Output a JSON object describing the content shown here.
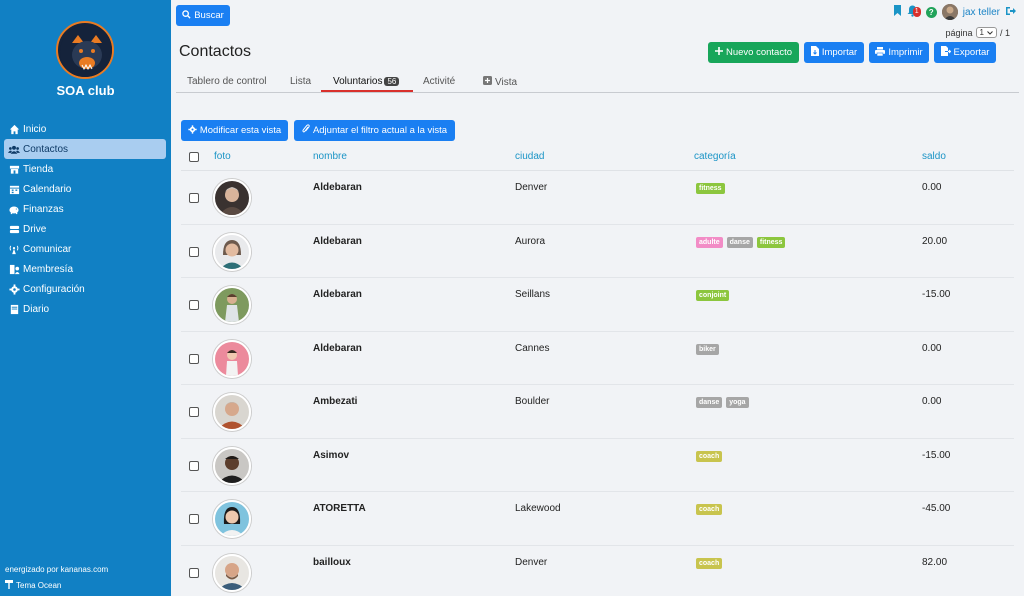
{
  "sidebar": {
    "club_name": "SOA club",
    "items": [
      {
        "label": "Inicio",
        "icon": "home-icon",
        "active": false
      },
      {
        "label": "Contactos",
        "icon": "users-icon",
        "active": true
      },
      {
        "label": "Tienda",
        "icon": "store-icon",
        "active": false
      },
      {
        "label": "Calendario",
        "icon": "calendar-icon",
        "active": false
      },
      {
        "label": "Finanzas",
        "icon": "piggy-bank-icon",
        "active": false
      },
      {
        "label": "Drive",
        "icon": "hard-drive-icon",
        "active": false
      },
      {
        "label": "Comunicar",
        "icon": "broadcast-icon",
        "active": false
      },
      {
        "label": "Membresía",
        "icon": "membership-icon",
        "active": false
      },
      {
        "label": "Configuración",
        "icon": "gear-icon",
        "active": false
      },
      {
        "label": "Diario",
        "icon": "journal-icon",
        "active": false
      }
    ],
    "powered_by": "energizado por kananas.com",
    "theme": "Tema Ocean"
  },
  "header": {
    "search_label": "Buscar",
    "page_title": "Contactos",
    "notifications_count": "1",
    "help": "?",
    "user_name": "jax teller",
    "pager_label": "página",
    "pager_value": "1",
    "pager_total": "/ 1",
    "new_contact": "Nuevo contacto",
    "import": "Importar",
    "print": "Imprimir",
    "export": "Exportar"
  },
  "tabs": [
    {
      "label": "Tablero de control"
    },
    {
      "label": "Lista"
    },
    {
      "label": "Voluntarios",
      "badge": "56"
    },
    {
      "label": "Activité"
    },
    {
      "label": "Vista"
    }
  ],
  "actions": {
    "modify_view": "Modificar esta vista",
    "attach_filter": "Adjuntar el filtro actual a la vista"
  },
  "table": {
    "columns": {
      "photo": "foto",
      "name": "nombre",
      "city": "ciudad",
      "category": "categoría",
      "balance": "saldo"
    },
    "rows": [
      {
        "name": "Aldebaran",
        "city": "Denver",
        "tags": [
          "fitness"
        ],
        "balance": "0.00"
      },
      {
        "name": "Aldebaran",
        "city": "Aurora",
        "tags": [
          "adulte",
          "danse",
          "fitness"
        ],
        "balance": "20.00"
      },
      {
        "name": "Aldebaran",
        "city": "Seillans",
        "tags": [
          "conjoint"
        ],
        "balance": "-15.00"
      },
      {
        "name": "Aldebaran",
        "city": "Cannes",
        "tags": [
          "biker"
        ],
        "balance": "0.00"
      },
      {
        "name": "Ambezati",
        "city": "Boulder",
        "tags": [
          "danse",
          "yoga"
        ],
        "balance": "0.00"
      },
      {
        "name": "Asimov",
        "city": "",
        "tags": [
          "coach"
        ],
        "balance": "-15.00"
      },
      {
        "name": "ATORETTA",
        "city": "Lakewood",
        "tags": [
          "coach"
        ],
        "balance": "-45.00"
      },
      {
        "name": "bailloux",
        "city": "Denver",
        "tags": [
          "coach"
        ],
        "balance": "82.00"
      }
    ]
  },
  "colors": {
    "sidebar": "#1180c4",
    "primary_button": "#1a7ff2",
    "success_button": "#18a65a",
    "tab_active_underline": "#d9302c",
    "tag_fitness": "#8cc63e",
    "tag_adulte": "#f28cc6",
    "tag_danse": "#a6a6a6",
    "tag_conjoint": "#8cc63e",
    "tag_biker": "#a6a6a6",
    "tag_yoga": "#a6a6a6",
    "tag_coach": "#c8c44e"
  }
}
